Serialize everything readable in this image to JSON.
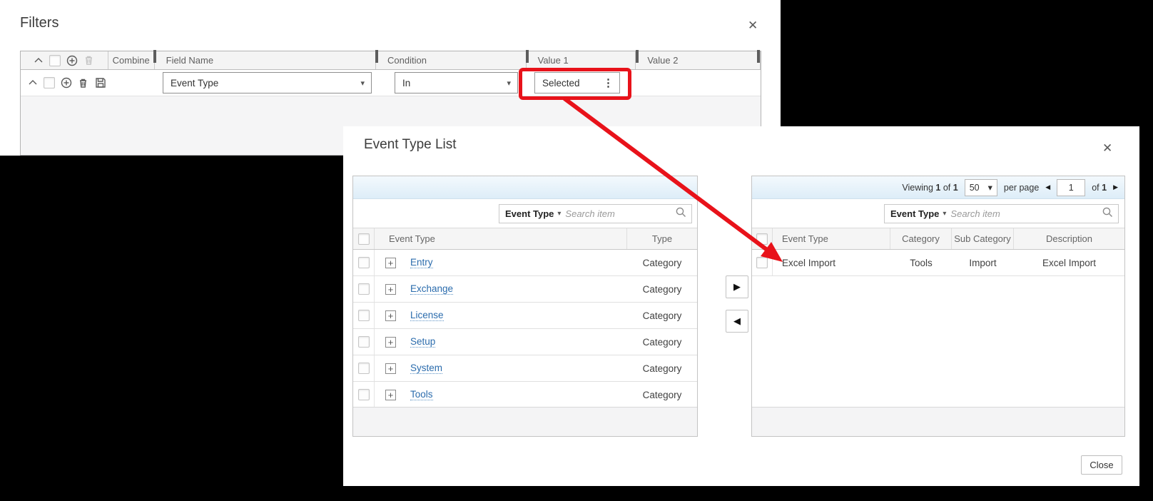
{
  "colors": {
    "annotation_red": "#e8121a",
    "link_blue": "#2b6cad"
  },
  "icons": {
    "close": "✕",
    "caret_down": "▾",
    "prev": "◀",
    "next": "▶",
    "ellipsis_v": "⋮",
    "expand_plus": "+",
    "move_right": "▶",
    "move_left": "◀",
    "chevron_up": "∧"
  },
  "filters_panel": {
    "title": "Filters",
    "columns": {
      "combine": "Combine",
      "field_name": "Field Name",
      "condition": "Condition",
      "value1": "Value 1",
      "value2": "Value 2"
    },
    "row": {
      "field_name": "Event Type",
      "condition": "In",
      "value1": "Selected"
    }
  },
  "dialog": {
    "title": "Event Type List",
    "close_button": "Close",
    "left_table": {
      "search": {
        "field": "Event Type",
        "placeholder": "Search item"
      },
      "columns": {
        "event_type": "Event Type",
        "type": "Type"
      },
      "rows": [
        {
          "name": "Entry",
          "type": "Category"
        },
        {
          "name": "Exchange",
          "type": "Category"
        },
        {
          "name": "License",
          "type": "Category"
        },
        {
          "name": "Setup",
          "type": "Category"
        },
        {
          "name": "System",
          "type": "Category"
        },
        {
          "name": "Tools",
          "type": "Category"
        }
      ]
    },
    "right_table": {
      "pagination": {
        "viewing_label": "Viewing",
        "viewing_count": "1",
        "of_label": "of",
        "viewing_total": "1",
        "page_size": "50",
        "per_page_label": "per page",
        "page_value": "1",
        "of_label2": "of",
        "page_total": "1"
      },
      "search": {
        "field": "Event Type",
        "placeholder": "Search item"
      },
      "columns": {
        "event_type": "Event Type",
        "category": "Category",
        "sub_category": "Sub Category",
        "description": "Description"
      },
      "rows": [
        {
          "event_type": "Excel Import",
          "category": "Tools",
          "sub_category": "Import",
          "description": "Excel Import"
        }
      ]
    }
  }
}
